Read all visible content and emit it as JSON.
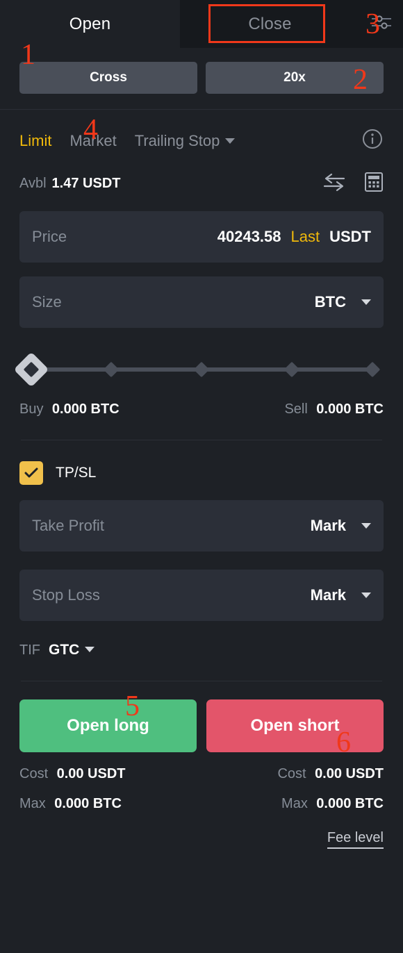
{
  "tabs": {
    "open_label": "Open",
    "close_label": "Close",
    "settings_icon": "sliders-icon"
  },
  "leverage": {
    "margin_mode": "Cross",
    "leverage_value": "20x"
  },
  "order_types": {
    "limit": "Limit",
    "market": "Market",
    "trailing_stop": "Trailing Stop",
    "info_icon": "info-circle-icon"
  },
  "available": {
    "label": "Avbl",
    "value": "1.47 USDT",
    "transfer_icon": "transfer-arrows-icon",
    "calculator_icon": "calculator-icon"
  },
  "price_field": {
    "placeholder": "Price",
    "value": "40243.58",
    "mode": "Last",
    "unit": "USDT"
  },
  "size_field": {
    "placeholder": "Size",
    "unit": "BTC"
  },
  "slider": {
    "position_percent": "0",
    "ticks": [
      "0",
      "25",
      "50",
      "75",
      "100"
    ]
  },
  "amounts": {
    "buy_label": "Buy",
    "buy_value": "0.000 BTC",
    "sell_label": "Sell",
    "sell_value": "0.000 BTC"
  },
  "tpsl": {
    "label": "TP/SL",
    "checked": true,
    "take_profit_placeholder": "Take Profit",
    "take_profit_ref": "Mark",
    "stop_loss_placeholder": "Stop Loss",
    "stop_loss_ref": "Mark"
  },
  "tif": {
    "label": "TIF",
    "value": "GTC"
  },
  "actions": {
    "long_label": "Open long",
    "short_label": "Open short",
    "long_color": "#4fbf7f",
    "short_color": "#e3556a"
  },
  "summary": {
    "long_cost_label": "Cost",
    "long_cost_value": "0.00 USDT",
    "short_cost_label": "Cost",
    "short_cost_value": "0.00 USDT",
    "long_max_label": "Max",
    "long_max_value": "0.000 BTC",
    "short_max_label": "Max",
    "short_max_value": "0.000 BTC",
    "fee_level_label": "Fee level"
  },
  "annotations": {
    "markers": [
      "1",
      "2",
      "3",
      "4",
      "5",
      "6"
    ],
    "color": "#f0381a"
  }
}
